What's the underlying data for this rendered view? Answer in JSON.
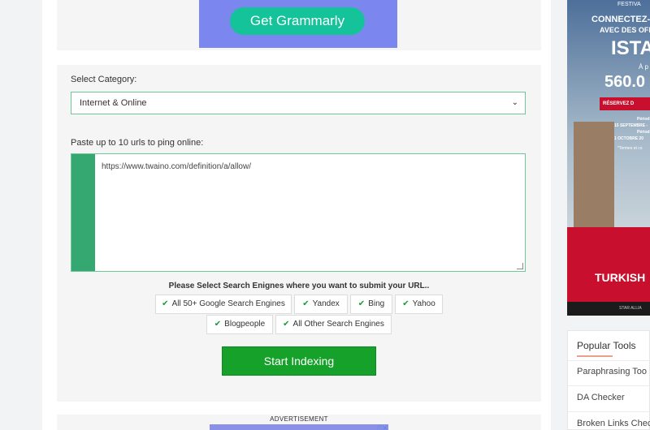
{
  "top_ad": {
    "cta": "Get Grammarly"
  },
  "form": {
    "category_label": "Select Category:",
    "category_value": "Internet & Online",
    "urls_label": "Paste up to 10 urls to ping online:",
    "urls_value": "https://www.twaino.com/definition/a/allow/",
    "engines_title": "Please Select Search Enignes where you want to submit your URL..",
    "engines": [
      "All 50+ Google Search Engines",
      "Yandex",
      "Bing",
      "Yahoo",
      "Blogpeople",
      "All Other Search Engines"
    ],
    "start_button": "Start Indexing"
  },
  "bottom_ad": {
    "label": "ADVERTISEMENT"
  },
  "side_ad": {
    "line1": "FESTIVA",
    "line2": "CONNECTEZ-V",
    "line3": "AVEC DES OFF",
    "line4": "ISTA",
    "line5": "À p",
    "line6": "560.0",
    "ribbon": "RÉSERVEZ D",
    "line7": "Périod",
    "line8": "15 SEPTEMBRE -",
    "line9": "Périod",
    "line10": "1 OCTOBRE 20",
    "line11": "*Termes et co",
    "brand": "TURKISH",
    "footer": "STAR ALLIA"
  },
  "popular_tools": {
    "title": "Popular Tools",
    "items": [
      "Paraphrasing Too",
      "DA Checker",
      "Broken Links Chec"
    ]
  }
}
